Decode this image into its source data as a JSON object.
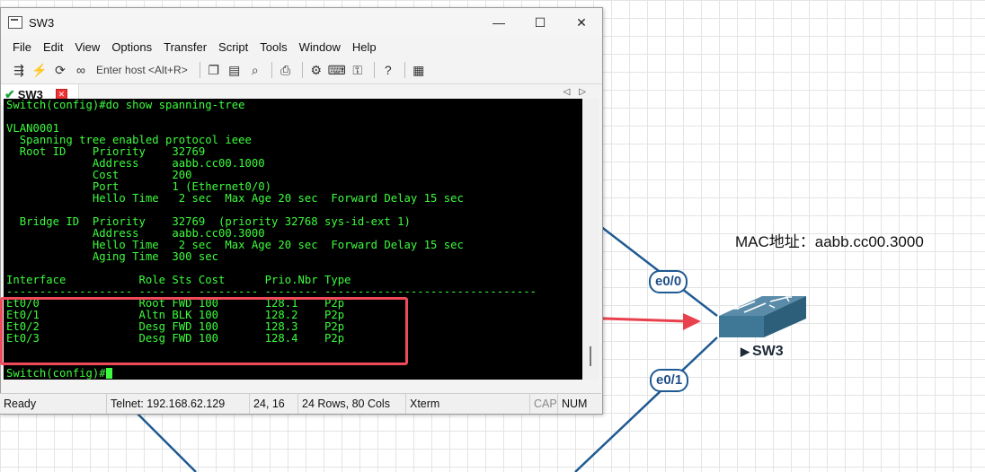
{
  "window": {
    "title": "SW3",
    "controls": {
      "minimize": "—",
      "maximize": "☐",
      "close": "✕"
    }
  },
  "menu": [
    "File",
    "Edit",
    "View",
    "Options",
    "Transfer",
    "Script",
    "Tools",
    "Window",
    "Help"
  ],
  "toolbar": {
    "host_placeholder": "Enter host <Alt+R>"
  },
  "tab": {
    "name": "SW3"
  },
  "terminal": {
    "lines": [
      "Switch(config)#do show spanning-tree",
      "",
      "VLAN0001",
      "  Spanning tree enabled protocol ieee",
      "  Root ID    Priority    32769",
      "             Address     aabb.cc00.1000",
      "             Cost        200",
      "             Port        1 (Ethernet0/0)",
      "             Hello Time   2 sec  Max Age 20 sec  Forward Delay 15 sec",
      "",
      "  Bridge ID  Priority    32769  (priority 32768 sys-id-ext 1)",
      "             Address     aabb.cc00.3000",
      "             Hello Time   2 sec  Max Age 20 sec  Forward Delay 15 sec",
      "             Aging Time  300 sec",
      "",
      "Interface           Role Sts Cost      Prio.Nbr Type",
      "------------------- ---- --- --------- -------- --------------------------------",
      "Et0/0               Root FWD 100       128.1    P2p",
      "Et0/1               Altn BLK 100       128.2    P2p",
      "Et0/2               Desg FWD 100       128.3    P2p",
      "Et0/3               Desg FWD 100       128.4    P2p",
      "",
      "",
      "Switch(config)#"
    ]
  },
  "status": {
    "ready": "Ready",
    "telnet": "Telnet: 192.168.62.129",
    "cursor": "24,  16",
    "size": "24 Rows, 80 Cols",
    "term": "Xterm",
    "cap": "CAP",
    "num": "NUM"
  },
  "topology": {
    "mac_label": "MAC地址：aabb.cc00.3000",
    "port_top": "e0/0",
    "port_bottom": "e0/1",
    "switch_name": "SW3",
    "colors": {
      "link": "#1f5a92",
      "switch": "#3f7896",
      "arrow": "#e8414d"
    }
  }
}
